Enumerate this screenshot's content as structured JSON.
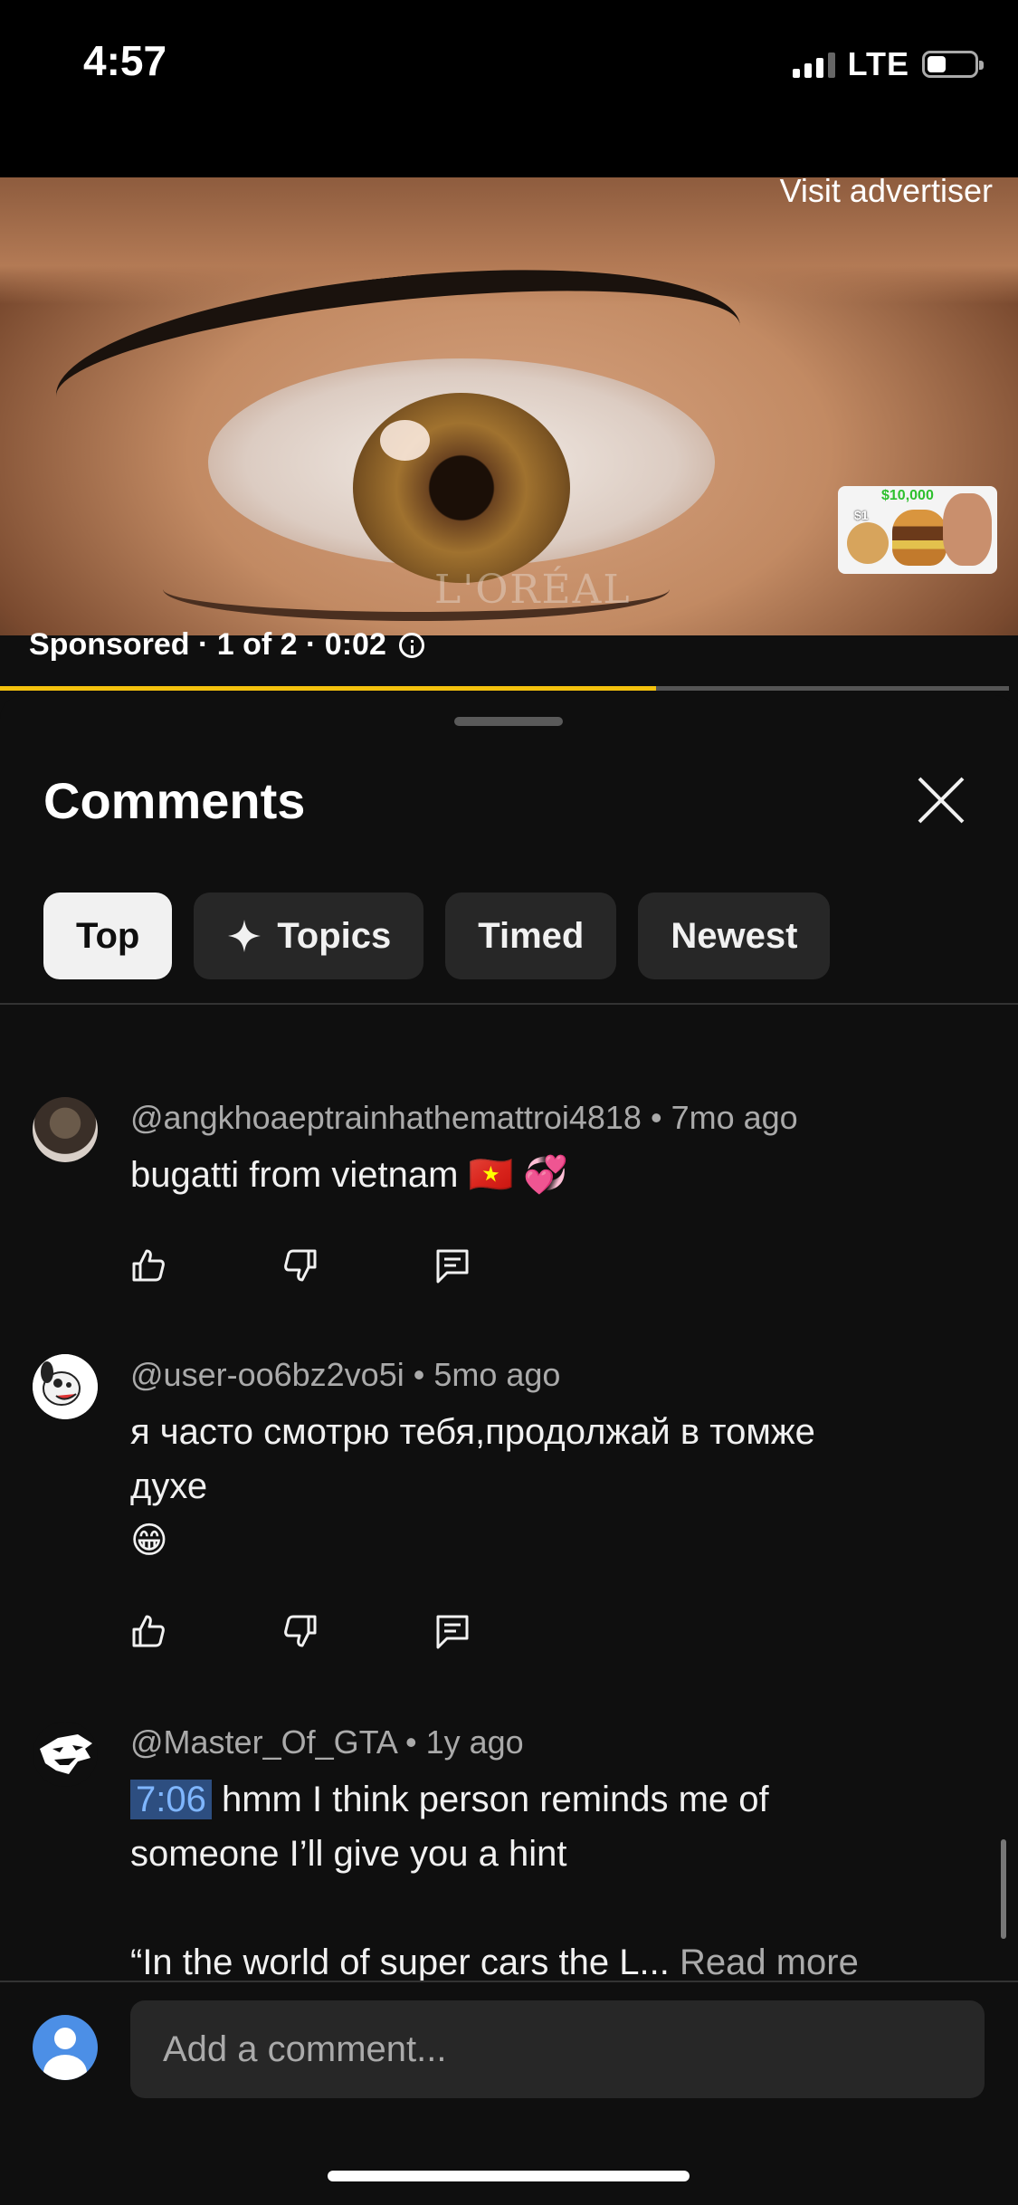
{
  "status_bar": {
    "time": "4:57",
    "network": "LTE"
  },
  "ad": {
    "visit_label": "Visit advertiser",
    "brand_watermark": "L'ORÉAL",
    "sponsored_text": "Sponsored · 1 of 2 · 0:02",
    "progress_fraction": 0.65,
    "thumbnail": {
      "price_tag": "$10,000",
      "cheap_tag": "$1"
    }
  },
  "comments_sheet": {
    "title": "Comments",
    "filters": [
      {
        "label": "Top",
        "active": true
      },
      {
        "label": "Topics",
        "icon": "sparkle-icon"
      },
      {
        "label": "Timed"
      },
      {
        "label": "Newest"
      }
    ],
    "comments": [
      {
        "author": "@angkhoaeptrainhathemattroi4818",
        "age": "7mo ago",
        "text": "bugatti from vietnam 🇻🇳 💞"
      },
      {
        "author": "@user-oo6bz2vo5i",
        "age": "5mo ago",
        "text_line1": "я часто смотрю тебя,продолжай в томже",
        "text_line2": "духе",
        "text_line3": "😁"
      },
      {
        "author": "@Master_Of_GTA",
        "age": "1y ago",
        "timestamp": "7:06",
        "text_line1": " hmm I think person reminds me of",
        "text_line2": "someone I’ll give you a hint",
        "text_line3": "“In the world of super cars the L...",
        "read_more": "Read more"
      }
    ],
    "separator": "•",
    "input_placeholder": "Add a comment..."
  }
}
